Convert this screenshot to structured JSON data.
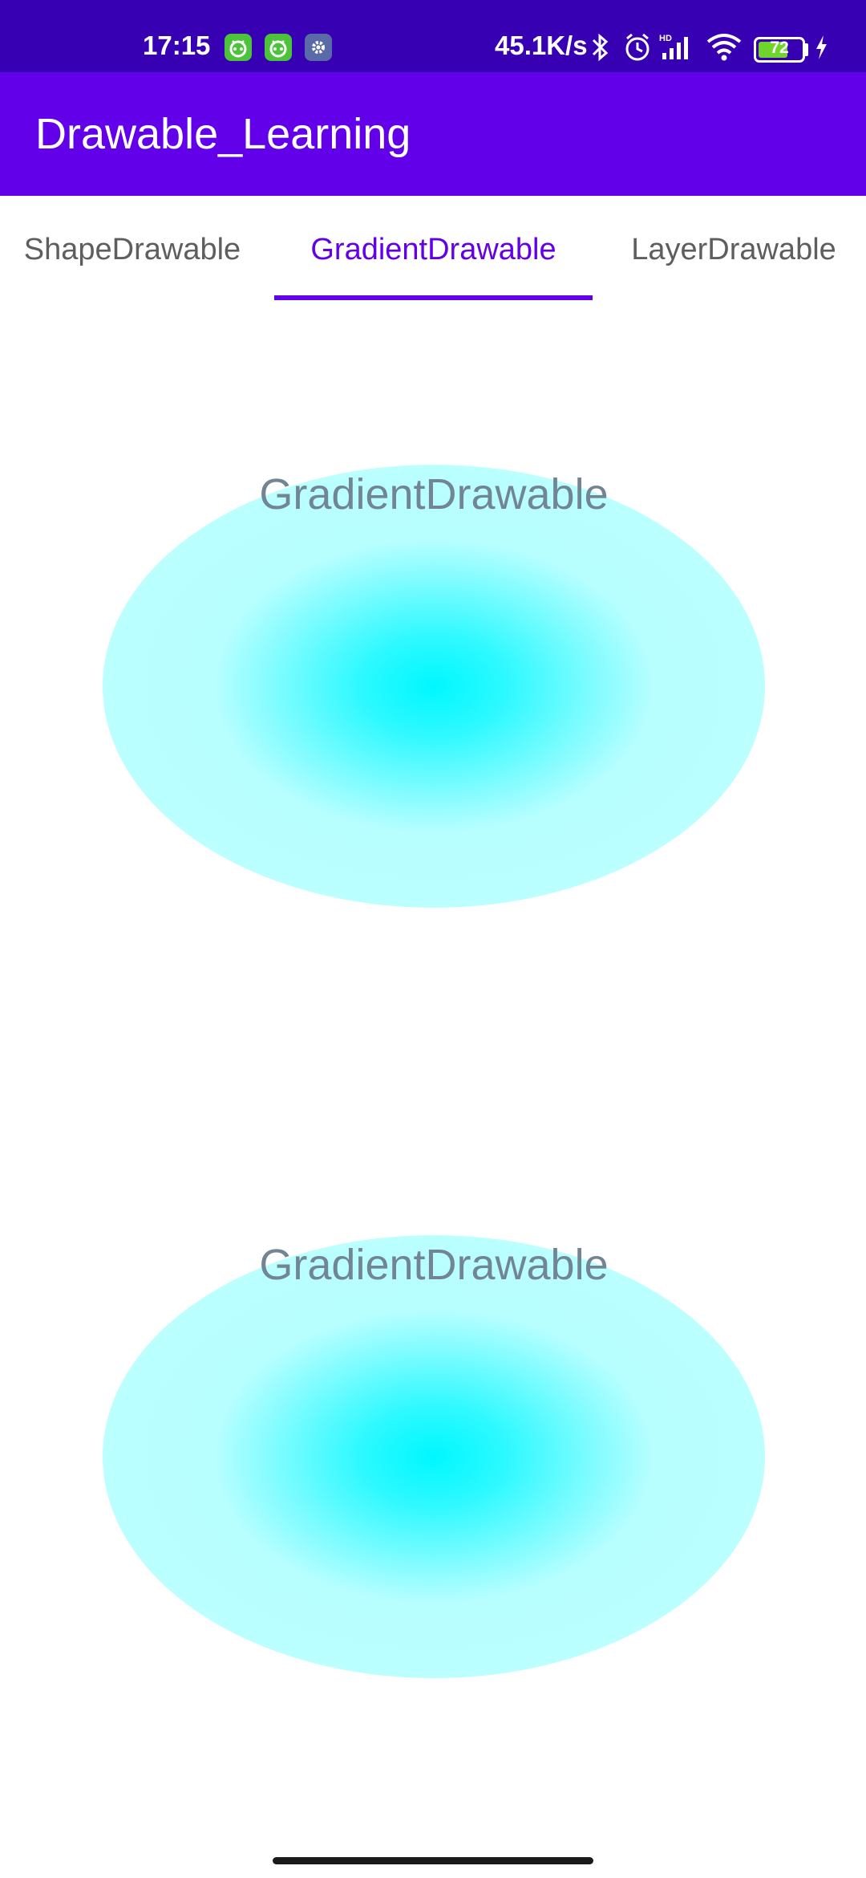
{
  "status_bar": {
    "time": "17:15",
    "network_speed": "45.1K/s",
    "battery_level": 72,
    "battery_label": "72",
    "background": "#3700b3",
    "icons": [
      "android-notification-icon",
      "android-notification-icon",
      "settings-notification-icon",
      "bluetooth-icon",
      "alarm-icon",
      "hd-signal-icon",
      "wifi-icon",
      "battery-icon",
      "charging-icon"
    ]
  },
  "app_bar": {
    "title": "Drawable_Learning",
    "background": "#6200ea"
  },
  "tabs": {
    "items": [
      {
        "label": "ShapeDrawable",
        "selected": false
      },
      {
        "label": "GradientDrawable",
        "selected": true
      },
      {
        "label": "LayerDrawable",
        "selected": false
      }
    ],
    "accent": "#6200ea"
  },
  "content": {
    "cards": [
      {
        "label": "GradientDrawable",
        "center_color": "#00f7ff",
        "edge_color": "#bbffff"
      },
      {
        "label": "GradientDrawable",
        "center_color": "#00f7ff",
        "edge_color": "#bbffff"
      }
    ]
  }
}
